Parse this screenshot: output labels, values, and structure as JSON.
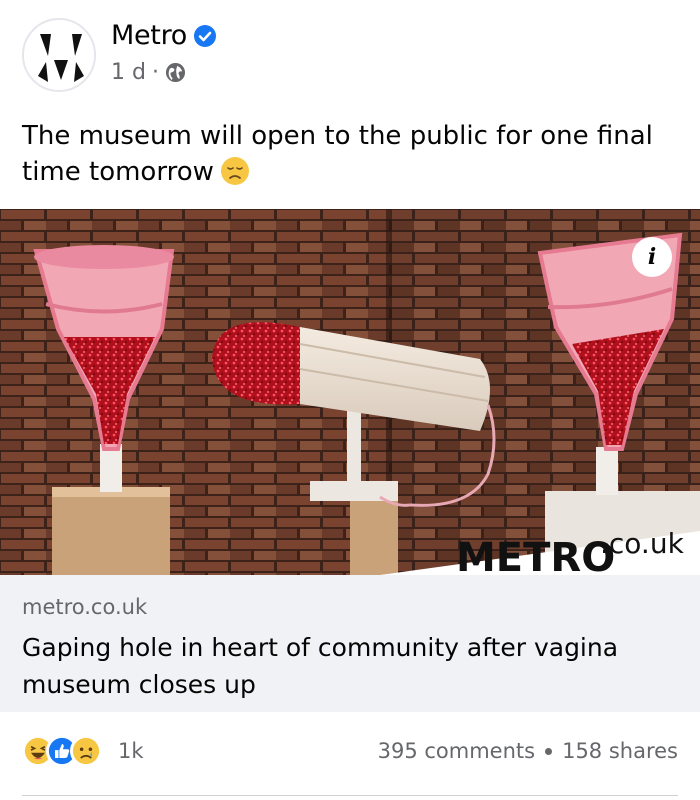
{
  "post": {
    "page_name": "Metro",
    "verified": true,
    "time": "1 d",
    "separator": "·",
    "audience_icon": "globe-icon",
    "text": "The museum will open to the public for one final time tomorrow",
    "emoji": "disappointed-face-emoji"
  },
  "image": {
    "watermark": "METRO",
    "watermark_suffix": ".co.uk",
    "info_label": "i"
  },
  "link_preview": {
    "domain": "metro.co.uk",
    "title": "Gaping hole in heart of community after vagina museum closes up"
  },
  "engagement": {
    "reaction_icons": [
      "haha-icon",
      "like-icon",
      "sad-icon"
    ],
    "reaction_count": "1k",
    "comments": "395 comments",
    "shares": "158 shares"
  },
  "colors": {
    "verified_blue": "#1877f2",
    "secondary_text": "#65676b",
    "link_bg": "#f0f2f5"
  }
}
